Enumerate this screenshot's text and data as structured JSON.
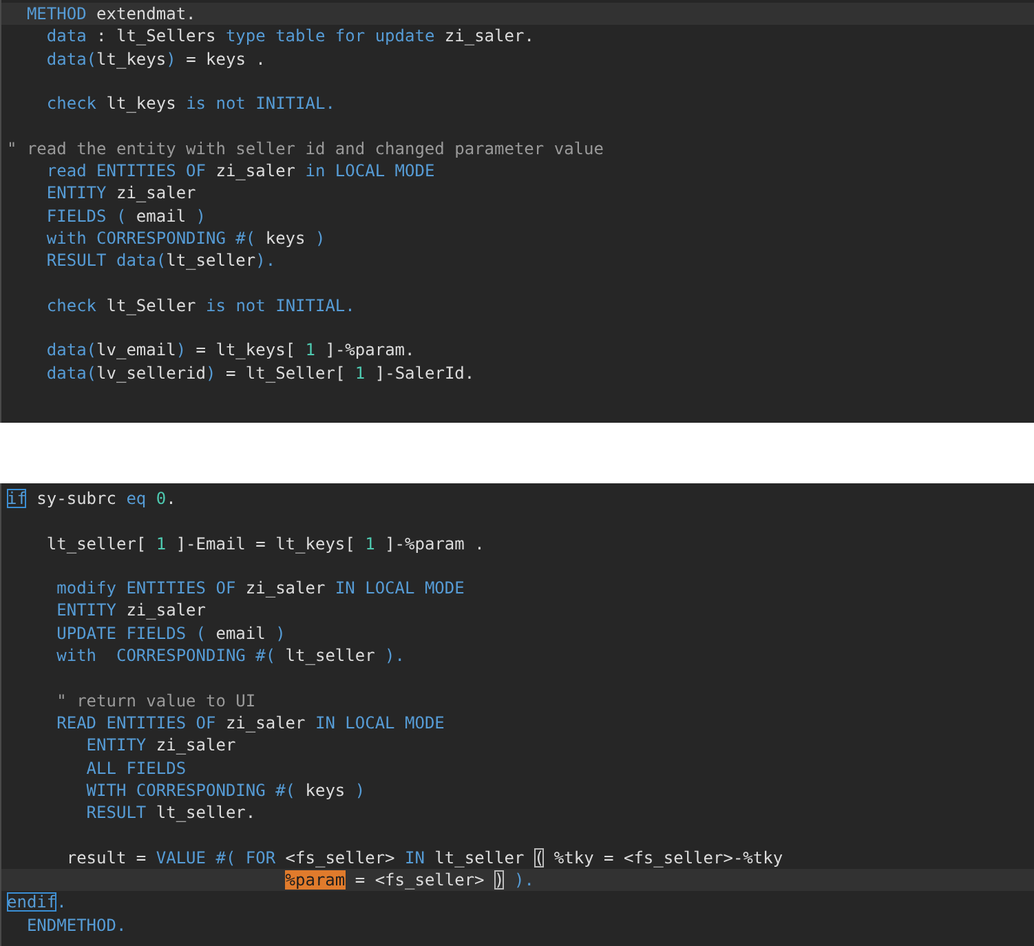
{
  "panels": [
    {
      "lines": [
        {
          "current": true,
          "tokens": [
            {
              "kind": "keyword",
              "text": "  METHOD"
            },
            {
              "kind": "name",
              "text": " extendmat."
            }
          ]
        },
        {
          "current": false,
          "tokens": [
            {
              "kind": "keyword",
              "text": "    data"
            },
            {
              "kind": "name",
              "text": " : lt_Sellers "
            },
            {
              "kind": "keyword",
              "text": "type table for update"
            },
            {
              "kind": "name",
              "text": " zi_saler."
            }
          ]
        },
        {
          "current": false,
          "tokens": [
            {
              "kind": "keyword",
              "text": "    data("
            },
            {
              "kind": "name",
              "text": "lt_keys"
            },
            {
              "kind": "keyword",
              "text": ")"
            },
            {
              "kind": "name",
              "text": " = keys ."
            }
          ]
        },
        {
          "kind": "blank"
        },
        {
          "current": false,
          "tokens": [
            {
              "kind": "keyword",
              "text": "    check"
            },
            {
              "kind": "name",
              "text": " lt_keys "
            },
            {
              "kind": "keyword",
              "text": "is not INITIAL."
            }
          ]
        },
        {
          "kind": "blank"
        },
        {
          "current": false,
          "tokens": [
            {
              "kind": "comment",
              "text": "\" read the entity with seller id and changed parameter value"
            }
          ]
        },
        {
          "current": false,
          "tokens": [
            {
              "kind": "keyword",
              "text": "    read ENTITIES OF"
            },
            {
              "kind": "name",
              "text": " zi_saler "
            },
            {
              "kind": "keyword",
              "text": "in LOCAL MODE"
            }
          ]
        },
        {
          "current": false,
          "tokens": [
            {
              "kind": "keyword",
              "text": "    ENTITY"
            },
            {
              "kind": "name",
              "text": " zi_saler"
            }
          ]
        },
        {
          "current": false,
          "tokens": [
            {
              "kind": "keyword",
              "text": "    FIELDS ( "
            },
            {
              "kind": "name",
              "text": "email"
            },
            {
              "kind": "keyword",
              "text": " )"
            }
          ]
        },
        {
          "current": false,
          "tokens": [
            {
              "kind": "keyword",
              "text": "    with CORRESPONDING #( "
            },
            {
              "kind": "name",
              "text": "keys"
            },
            {
              "kind": "keyword",
              "text": " )"
            }
          ]
        },
        {
          "current": false,
          "tokens": [
            {
              "kind": "keyword",
              "text": "    RESULT data("
            },
            {
              "kind": "name",
              "text": "lt_seller"
            },
            {
              "kind": "keyword",
              "text": ")."
            }
          ]
        },
        {
          "kind": "blank"
        },
        {
          "current": false,
          "tokens": [
            {
              "kind": "keyword",
              "text": "    check"
            },
            {
              "kind": "name",
              "text": " lt_Seller "
            },
            {
              "kind": "keyword",
              "text": "is not INITIAL."
            }
          ]
        },
        {
          "kind": "blank"
        },
        {
          "current": false,
          "tokens": [
            {
              "kind": "keyword",
              "text": "    data("
            },
            {
              "kind": "name",
              "text": "lv_email"
            },
            {
              "kind": "keyword",
              "text": ")"
            },
            {
              "kind": "name",
              "text": " = lt_keys[ "
            },
            {
              "kind": "number",
              "text": "1"
            },
            {
              "kind": "name",
              "text": " ]-%param."
            }
          ]
        },
        {
          "current": false,
          "tokens": [
            {
              "kind": "keyword",
              "text": "    data("
            },
            {
              "kind": "name",
              "text": "lv_sellerid"
            },
            {
              "kind": "keyword",
              "text": ")"
            },
            {
              "kind": "name",
              "text": " = lt_Seller[ "
            },
            {
              "kind": "number",
              "text": "1"
            },
            {
              "kind": "name",
              "text": " ]-SalerId."
            }
          ]
        }
      ]
    },
    {
      "lines": [
        {
          "current": false,
          "tokens": [
            {
              "kind": "match",
              "text": "if"
            },
            {
              "kind": "name",
              "text": " sy-subrc "
            },
            {
              "kind": "keyword",
              "text": "eq "
            },
            {
              "kind": "number",
              "text": "0"
            },
            {
              "kind": "name",
              "text": "."
            }
          ]
        },
        {
          "kind": "blank"
        },
        {
          "current": false,
          "tokens": [
            {
              "kind": "name",
              "text": "    lt_seller[ "
            },
            {
              "kind": "number",
              "text": "1"
            },
            {
              "kind": "name",
              "text": " ]-Email = lt_keys[ "
            },
            {
              "kind": "number",
              "text": "1"
            },
            {
              "kind": "name",
              "text": " ]-%param ."
            }
          ]
        },
        {
          "kind": "blank"
        },
        {
          "current": false,
          "tokens": [
            {
              "kind": "keyword",
              "text": "     modify ENTITIES OF"
            },
            {
              "kind": "name",
              "text": " zi_saler "
            },
            {
              "kind": "keyword",
              "text": "IN LOCAL MODE"
            }
          ]
        },
        {
          "current": false,
          "tokens": [
            {
              "kind": "keyword",
              "text": "     ENTITY"
            },
            {
              "kind": "name",
              "text": " zi_saler"
            }
          ]
        },
        {
          "current": false,
          "tokens": [
            {
              "kind": "keyword",
              "text": "     UPDATE FIELDS ( "
            },
            {
              "kind": "name",
              "text": "email"
            },
            {
              "kind": "keyword",
              "text": " )"
            }
          ]
        },
        {
          "current": false,
          "tokens": [
            {
              "kind": "keyword",
              "text": "     with  CORRESPONDING #( "
            },
            {
              "kind": "name",
              "text": "lt_seller"
            },
            {
              "kind": "keyword",
              "text": " )."
            }
          ]
        },
        {
          "kind": "blank"
        },
        {
          "current": false,
          "tokens": [
            {
              "kind": "comment",
              "text": "     \" return value to UI"
            }
          ]
        },
        {
          "current": false,
          "tokens": [
            {
              "kind": "keyword",
              "text": "     READ ENTITIES OF"
            },
            {
              "kind": "name",
              "text": " zi_saler "
            },
            {
              "kind": "keyword",
              "text": "IN LOCAL MODE"
            }
          ]
        },
        {
          "current": false,
          "tokens": [
            {
              "kind": "keyword",
              "text": "        ENTITY"
            },
            {
              "kind": "name",
              "text": " zi_saler"
            }
          ]
        },
        {
          "current": false,
          "tokens": [
            {
              "kind": "keyword",
              "text": "        ALL FIELDS"
            }
          ]
        },
        {
          "current": false,
          "tokens": [
            {
              "kind": "keyword",
              "text": "        WITH CORRESPONDING #( "
            },
            {
              "kind": "name",
              "text": "keys"
            },
            {
              "kind": "keyword",
              "text": " )"
            }
          ]
        },
        {
          "current": false,
          "tokens": [
            {
              "kind": "keyword",
              "text": "        RESULT"
            },
            {
              "kind": "name",
              "text": " lt_seller."
            }
          ]
        },
        {
          "kind": "blank"
        },
        {
          "current": false,
          "tokens": [
            {
              "kind": "name",
              "text": "      result = "
            },
            {
              "kind": "keyword",
              "text": "VALUE #( FOR"
            },
            {
              "kind": "name",
              "text": " <fs_seller> "
            },
            {
              "kind": "keyword",
              "text": "IN"
            },
            {
              "kind": "name",
              "text": " lt_seller "
            },
            {
              "kind": "bracket",
              "text": "("
            },
            {
              "kind": "name",
              "text": " %tky = <fs_seller>-%tky"
            }
          ]
        },
        {
          "current": true,
          "kind": "continuation",
          "tokens": [
            {
              "kind": "occurrence",
              "text": "%param"
            },
            {
              "kind": "name",
              "text": " = <fs_seller> "
            },
            {
              "kind": "bracket",
              "text": ")"
            },
            {
              "kind": "keyword",
              "text": " )."
            }
          ]
        },
        {
          "current": false,
          "tokens": [
            {
              "kind": "match",
              "text": "endif"
            },
            {
              "kind": "keyword",
              "text": "."
            }
          ]
        },
        {
          "current": false,
          "tokens": [
            {
              "kind": "keyword",
              "text": "  ENDMETHOD."
            }
          ]
        }
      ]
    }
  ]
}
